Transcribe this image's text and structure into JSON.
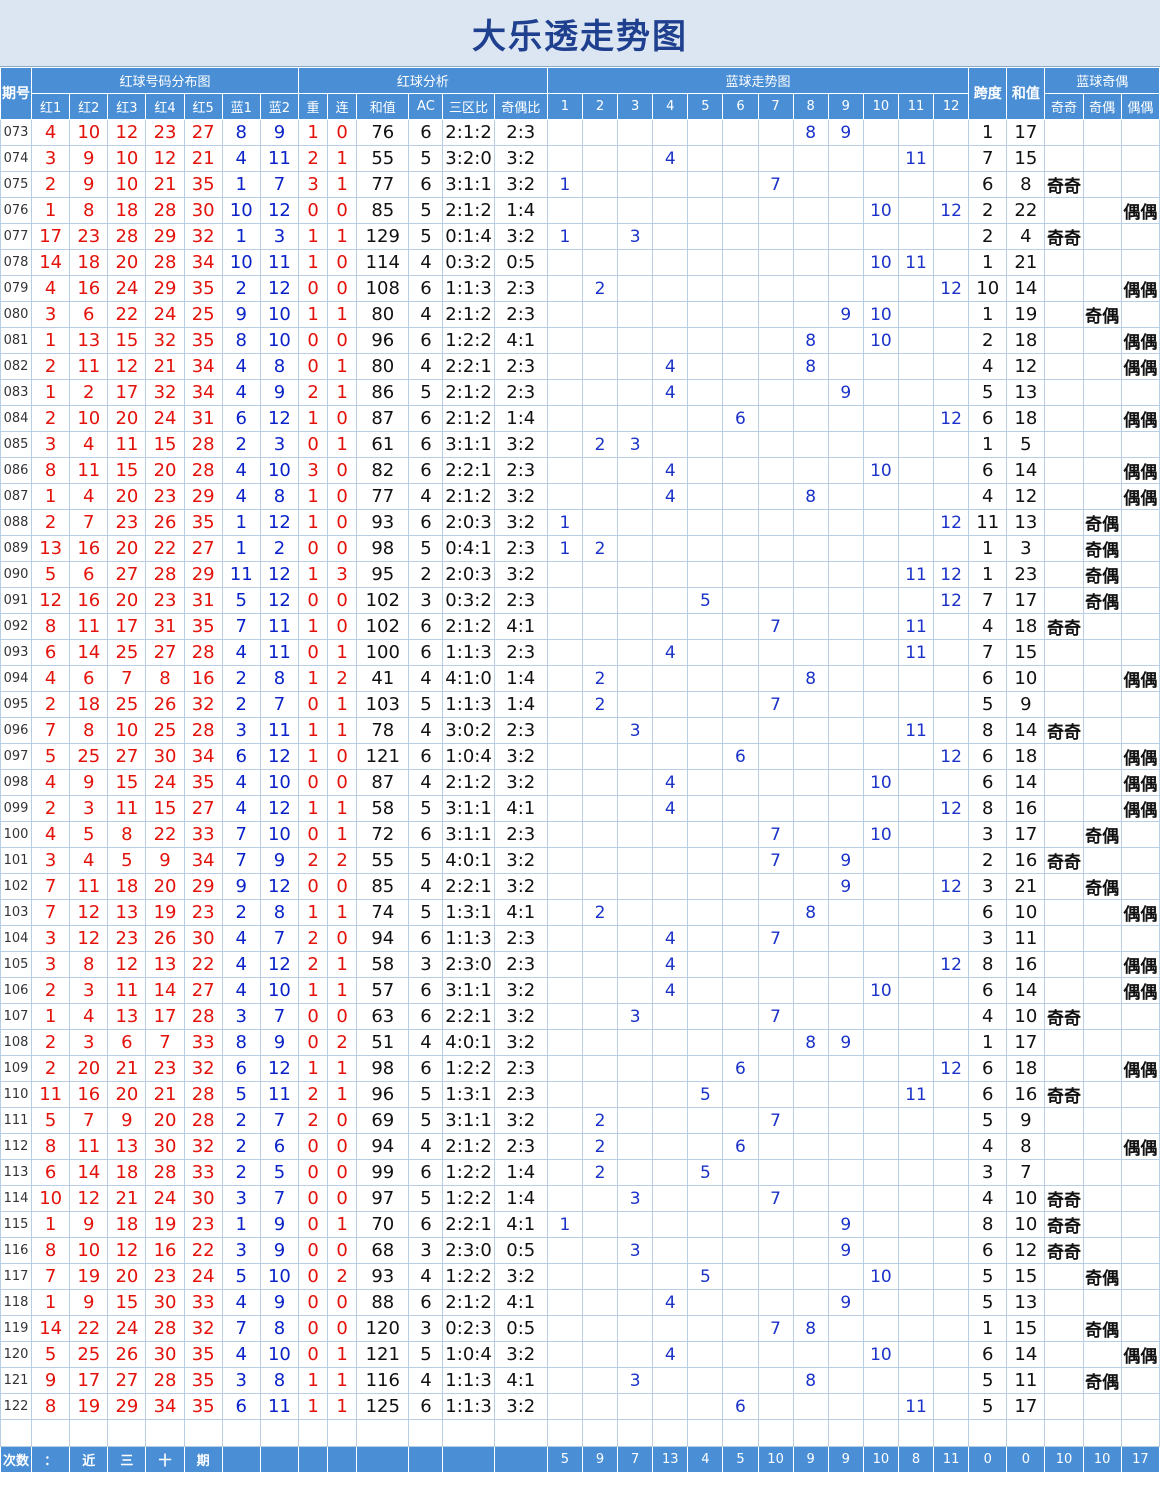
{
  "title": "大乐透走势图",
  "header": {
    "period": "期号",
    "red_dist": "红球号码分布图",
    "red_analysis": "红球分析",
    "blue_trend": "蓝球走势图",
    "span": "跨度",
    "sum": "和值",
    "blue_oe": "蓝球奇偶",
    "cols": [
      "红1",
      "红2",
      "红3",
      "红4",
      "红5",
      "蓝1",
      "蓝2",
      "重",
      "连",
      "和值",
      "AC",
      "三区比",
      "奇偶比",
      "1",
      "2",
      "3",
      "4",
      "5",
      "6",
      "7",
      "8",
      "9",
      "10",
      "11",
      "12",
      "奇奇",
      "奇偶",
      "偶偶"
    ]
  },
  "rows": [
    {
      "p": "073",
      "r": [
        "4",
        "10",
        "12",
        "23",
        "27"
      ],
      "b": [
        "8",
        "9"
      ],
      "c": "1",
      "l": "0",
      "s": "76",
      "ac": "6",
      "z": "2:1:2",
      "oe": "2:3",
      "kd": "1",
      "hz": "17",
      "o": ""
    },
    {
      "p": "074",
      "r": [
        "3",
        "9",
        "10",
        "12",
        "21"
      ],
      "b": [
        "4",
        "11"
      ],
      "c": "2",
      "l": "1",
      "s": "55",
      "ac": "5",
      "z": "3:2:0",
      "oe": "3:2",
      "kd": "7",
      "hz": "15",
      "o": ""
    },
    {
      "p": "075",
      "r": [
        "2",
        "9",
        "10",
        "21",
        "35"
      ],
      "b": [
        "1",
        "7"
      ],
      "c": "3",
      "l": "1",
      "s": "77",
      "ac": "6",
      "z": "3:1:1",
      "oe": "3:2",
      "kd": "6",
      "hz": "8",
      "o": "奇奇"
    },
    {
      "p": "076",
      "r": [
        "1",
        "8",
        "18",
        "28",
        "30"
      ],
      "b": [
        "10",
        "12"
      ],
      "c": "0",
      "l": "0",
      "s": "85",
      "ac": "5",
      "z": "2:1:2",
      "oe": "1:4",
      "kd": "2",
      "hz": "22",
      "o": "偶偶"
    },
    {
      "p": "077",
      "r": [
        "17",
        "23",
        "28",
        "29",
        "32"
      ],
      "b": [
        "1",
        "3"
      ],
      "c": "1",
      "l": "1",
      "s": "129",
      "ac": "5",
      "z": "0:1:4",
      "oe": "3:2",
      "kd": "2",
      "hz": "4",
      "o": "奇奇"
    },
    {
      "p": "078",
      "r": [
        "14",
        "18",
        "20",
        "28",
        "34"
      ],
      "b": [
        "10",
        "11"
      ],
      "c": "1",
      "l": "0",
      "s": "114",
      "ac": "4",
      "z": "0:3:2",
      "oe": "0:5",
      "kd": "1",
      "hz": "21",
      "o": ""
    },
    {
      "p": "079",
      "r": [
        "4",
        "16",
        "24",
        "29",
        "35"
      ],
      "b": [
        "2",
        "12"
      ],
      "c": "0",
      "l": "0",
      "s": "108",
      "ac": "6",
      "z": "1:1:3",
      "oe": "2:3",
      "kd": "10",
      "hz": "14",
      "o": "偶偶"
    },
    {
      "p": "080",
      "r": [
        "3",
        "6",
        "22",
        "24",
        "25"
      ],
      "b": [
        "9",
        "10"
      ],
      "c": "1",
      "l": "1",
      "s": "80",
      "ac": "4",
      "z": "2:1:2",
      "oe": "2:3",
      "kd": "1",
      "hz": "19",
      "o": "奇偶"
    },
    {
      "p": "081",
      "r": [
        "1",
        "13",
        "15",
        "32",
        "35"
      ],
      "b": [
        "8",
        "10"
      ],
      "c": "0",
      "l": "0",
      "s": "96",
      "ac": "6",
      "z": "1:2:2",
      "oe": "4:1",
      "kd": "2",
      "hz": "18",
      "o": "偶偶"
    },
    {
      "p": "082",
      "r": [
        "2",
        "11",
        "12",
        "21",
        "34"
      ],
      "b": [
        "4",
        "8"
      ],
      "c": "0",
      "l": "1",
      "s": "80",
      "ac": "4",
      "z": "2:2:1",
      "oe": "2:3",
      "kd": "4",
      "hz": "12",
      "o": "偶偶"
    },
    {
      "p": "083",
      "r": [
        "1",
        "2",
        "17",
        "32",
        "34"
      ],
      "b": [
        "4",
        "9"
      ],
      "c": "2",
      "l": "1",
      "s": "86",
      "ac": "5",
      "z": "2:1:2",
      "oe": "2:3",
      "kd": "5",
      "hz": "13",
      "o": ""
    },
    {
      "p": "084",
      "r": [
        "2",
        "10",
        "20",
        "24",
        "31"
      ],
      "b": [
        "6",
        "12"
      ],
      "c": "1",
      "l": "0",
      "s": "87",
      "ac": "6",
      "z": "2:1:2",
      "oe": "1:4",
      "kd": "6",
      "hz": "18",
      "o": "偶偶"
    },
    {
      "p": "085",
      "r": [
        "3",
        "4",
        "11",
        "15",
        "28"
      ],
      "b": [
        "2",
        "3"
      ],
      "c": "0",
      "l": "1",
      "s": "61",
      "ac": "6",
      "z": "3:1:1",
      "oe": "3:2",
      "kd": "1",
      "hz": "5",
      "o": ""
    },
    {
      "p": "086",
      "r": [
        "8",
        "11",
        "15",
        "20",
        "28"
      ],
      "b": [
        "4",
        "10"
      ],
      "c": "3",
      "l": "0",
      "s": "82",
      "ac": "6",
      "z": "2:2:1",
      "oe": "2:3",
      "kd": "6",
      "hz": "14",
      "o": "偶偶"
    },
    {
      "p": "087",
      "r": [
        "1",
        "4",
        "20",
        "23",
        "29"
      ],
      "b": [
        "4",
        "8"
      ],
      "c": "1",
      "l": "0",
      "s": "77",
      "ac": "4",
      "z": "2:1:2",
      "oe": "3:2",
      "kd": "4",
      "hz": "12",
      "o": "偶偶"
    },
    {
      "p": "088",
      "r": [
        "2",
        "7",
        "23",
        "26",
        "35"
      ],
      "b": [
        "1",
        "12"
      ],
      "c": "1",
      "l": "0",
      "s": "93",
      "ac": "6",
      "z": "2:0:3",
      "oe": "3:2",
      "kd": "11",
      "hz": "13",
      "o": "奇偶"
    },
    {
      "p": "089",
      "r": [
        "13",
        "16",
        "20",
        "22",
        "27"
      ],
      "b": [
        "1",
        "2"
      ],
      "c": "0",
      "l": "0",
      "s": "98",
      "ac": "5",
      "z": "0:4:1",
      "oe": "2:3",
      "kd": "1",
      "hz": "3",
      "o": "奇偶"
    },
    {
      "p": "090",
      "r": [
        "5",
        "6",
        "27",
        "28",
        "29"
      ],
      "b": [
        "11",
        "12"
      ],
      "c": "1",
      "l": "3",
      "s": "95",
      "ac": "2",
      "z": "2:0:3",
      "oe": "3:2",
      "kd": "1",
      "hz": "23",
      "o": "奇偶"
    },
    {
      "p": "091",
      "r": [
        "12",
        "16",
        "20",
        "23",
        "31"
      ],
      "b": [
        "5",
        "12"
      ],
      "c": "0",
      "l": "0",
      "s": "102",
      "ac": "3",
      "z": "0:3:2",
      "oe": "2:3",
      "kd": "7",
      "hz": "17",
      "o": "奇偶"
    },
    {
      "p": "092",
      "r": [
        "8",
        "11",
        "17",
        "31",
        "35"
      ],
      "b": [
        "7",
        "11"
      ],
      "c": "1",
      "l": "0",
      "s": "102",
      "ac": "6",
      "z": "2:1:2",
      "oe": "4:1",
      "kd": "4",
      "hz": "18",
      "o": "奇奇"
    },
    {
      "p": "093",
      "r": [
        "6",
        "14",
        "25",
        "27",
        "28"
      ],
      "b": [
        "4",
        "11"
      ],
      "c": "0",
      "l": "1",
      "s": "100",
      "ac": "6",
      "z": "1:1:3",
      "oe": "2:3",
      "kd": "7",
      "hz": "15",
      "o": ""
    },
    {
      "p": "094",
      "r": [
        "4",
        "6",
        "7",
        "8",
        "16"
      ],
      "b": [
        "2",
        "8"
      ],
      "c": "1",
      "l": "2",
      "s": "41",
      "ac": "4",
      "z": "4:1:0",
      "oe": "1:4",
      "kd": "6",
      "hz": "10",
      "o": "偶偶"
    },
    {
      "p": "095",
      "r": [
        "2",
        "18",
        "25",
        "26",
        "32"
      ],
      "b": [
        "2",
        "7"
      ],
      "c": "0",
      "l": "1",
      "s": "103",
      "ac": "5",
      "z": "1:1:3",
      "oe": "1:4",
      "kd": "5",
      "hz": "9",
      "o": ""
    },
    {
      "p": "096",
      "r": [
        "7",
        "8",
        "10",
        "25",
        "28"
      ],
      "b": [
        "3",
        "11"
      ],
      "c": "1",
      "l": "1",
      "s": "78",
      "ac": "4",
      "z": "3:0:2",
      "oe": "2:3",
      "kd": "8",
      "hz": "14",
      "o": "奇奇"
    },
    {
      "p": "097",
      "r": [
        "5",
        "25",
        "27",
        "30",
        "34"
      ],
      "b": [
        "6",
        "12"
      ],
      "c": "1",
      "l": "0",
      "s": "121",
      "ac": "6",
      "z": "1:0:4",
      "oe": "3:2",
      "kd": "6",
      "hz": "18",
      "o": "偶偶"
    },
    {
      "p": "098",
      "r": [
        "4",
        "9",
        "15",
        "24",
        "35"
      ],
      "b": [
        "4",
        "10"
      ],
      "c": "0",
      "l": "0",
      "s": "87",
      "ac": "4",
      "z": "2:1:2",
      "oe": "3:2",
      "kd": "6",
      "hz": "14",
      "o": "偶偶"
    },
    {
      "p": "099",
      "r": [
        "2",
        "3",
        "11",
        "15",
        "27"
      ],
      "b": [
        "4",
        "12"
      ],
      "c": "1",
      "l": "1",
      "s": "58",
      "ac": "5",
      "z": "3:1:1",
      "oe": "4:1",
      "kd": "8",
      "hz": "16",
      "o": "偶偶"
    },
    {
      "p": "100",
      "r": [
        "4",
        "5",
        "8",
        "22",
        "33"
      ],
      "b": [
        "7",
        "10"
      ],
      "c": "0",
      "l": "1",
      "s": "72",
      "ac": "6",
      "z": "3:1:1",
      "oe": "2:3",
      "kd": "3",
      "hz": "17",
      "o": "奇偶"
    },
    {
      "p": "101",
      "r": [
        "3",
        "4",
        "5",
        "9",
        "34"
      ],
      "b": [
        "7",
        "9"
      ],
      "c": "2",
      "l": "2",
      "s": "55",
      "ac": "5",
      "z": "4:0:1",
      "oe": "3:2",
      "kd": "2",
      "hz": "16",
      "o": "奇奇"
    },
    {
      "p": "102",
      "r": [
        "7",
        "11",
        "18",
        "20",
        "29"
      ],
      "b": [
        "9",
        "12"
      ],
      "c": "0",
      "l": "0",
      "s": "85",
      "ac": "4",
      "z": "2:2:1",
      "oe": "3:2",
      "kd": "3",
      "hz": "21",
      "o": "奇偶"
    },
    {
      "p": "103",
      "r": [
        "7",
        "12",
        "13",
        "19",
        "23"
      ],
      "b": [
        "2",
        "8"
      ],
      "c": "1",
      "l": "1",
      "s": "74",
      "ac": "5",
      "z": "1:3:1",
      "oe": "4:1",
      "kd": "6",
      "hz": "10",
      "o": "偶偶"
    },
    {
      "p": "104",
      "r": [
        "3",
        "12",
        "23",
        "26",
        "30"
      ],
      "b": [
        "4",
        "7"
      ],
      "c": "2",
      "l": "0",
      "s": "94",
      "ac": "6",
      "z": "1:1:3",
      "oe": "2:3",
      "kd": "3",
      "hz": "11",
      "o": ""
    },
    {
      "p": "105",
      "r": [
        "3",
        "8",
        "12",
        "13",
        "22"
      ],
      "b": [
        "4",
        "12"
      ],
      "c": "2",
      "l": "1",
      "s": "58",
      "ac": "3",
      "z": "2:3:0",
      "oe": "2:3",
      "kd": "8",
      "hz": "16",
      "o": "偶偶"
    },
    {
      "p": "106",
      "r": [
        "2",
        "3",
        "11",
        "14",
        "27"
      ],
      "b": [
        "4",
        "10"
      ],
      "c": "1",
      "l": "1",
      "s": "57",
      "ac": "6",
      "z": "3:1:1",
      "oe": "3:2",
      "kd": "6",
      "hz": "14",
      "o": "偶偶"
    },
    {
      "p": "107",
      "r": [
        "1",
        "4",
        "13",
        "17",
        "28"
      ],
      "b": [
        "3",
        "7"
      ],
      "c": "0",
      "l": "0",
      "s": "63",
      "ac": "6",
      "z": "2:2:1",
      "oe": "3:2",
      "kd": "4",
      "hz": "10",
      "o": "奇奇"
    },
    {
      "p": "108",
      "r": [
        "2",
        "3",
        "6",
        "7",
        "33"
      ],
      "b": [
        "8",
        "9"
      ],
      "c": "0",
      "l": "2",
      "s": "51",
      "ac": "4",
      "z": "4:0:1",
      "oe": "3:2",
      "kd": "1",
      "hz": "17",
      "o": ""
    },
    {
      "p": "109",
      "r": [
        "2",
        "20",
        "21",
        "23",
        "32"
      ],
      "b": [
        "6",
        "12"
      ],
      "c": "1",
      "l": "1",
      "s": "98",
      "ac": "6",
      "z": "1:2:2",
      "oe": "2:3",
      "kd": "6",
      "hz": "18",
      "o": "偶偶"
    },
    {
      "p": "110",
      "r": [
        "11",
        "16",
        "20",
        "21",
        "28"
      ],
      "b": [
        "5",
        "11"
      ],
      "c": "2",
      "l": "1",
      "s": "96",
      "ac": "5",
      "z": "1:3:1",
      "oe": "2:3",
      "kd": "6",
      "hz": "16",
      "o": "奇奇"
    },
    {
      "p": "111",
      "r": [
        "5",
        "7",
        "9",
        "20",
        "28"
      ],
      "b": [
        "2",
        "7"
      ],
      "c": "2",
      "l": "0",
      "s": "69",
      "ac": "5",
      "z": "3:1:1",
      "oe": "3:2",
      "kd": "5",
      "hz": "9",
      "o": ""
    },
    {
      "p": "112",
      "r": [
        "8",
        "11",
        "13",
        "30",
        "32"
      ],
      "b": [
        "2",
        "6"
      ],
      "c": "0",
      "l": "0",
      "s": "94",
      "ac": "4",
      "z": "2:1:2",
      "oe": "2:3",
      "kd": "4",
      "hz": "8",
      "o": "偶偶"
    },
    {
      "p": "113",
      "r": [
        "6",
        "14",
        "18",
        "28",
        "33"
      ],
      "b": [
        "2",
        "5"
      ],
      "c": "0",
      "l": "0",
      "s": "99",
      "ac": "6",
      "z": "1:2:2",
      "oe": "1:4",
      "kd": "3",
      "hz": "7",
      "o": ""
    },
    {
      "p": "114",
      "r": [
        "10",
        "12",
        "21",
        "24",
        "30"
      ],
      "b": [
        "3",
        "7"
      ],
      "c": "0",
      "l": "0",
      "s": "97",
      "ac": "5",
      "z": "1:2:2",
      "oe": "1:4",
      "kd": "4",
      "hz": "10",
      "o": "奇奇"
    },
    {
      "p": "115",
      "r": [
        "1",
        "9",
        "18",
        "19",
        "23"
      ],
      "b": [
        "1",
        "9"
      ],
      "c": "0",
      "l": "1",
      "s": "70",
      "ac": "6",
      "z": "2:2:1",
      "oe": "4:1",
      "kd": "8",
      "hz": "10",
      "o": "奇奇"
    },
    {
      "p": "116",
      "r": [
        "8",
        "10",
        "12",
        "16",
        "22"
      ],
      "b": [
        "3",
        "9"
      ],
      "c": "0",
      "l": "0",
      "s": "68",
      "ac": "3",
      "z": "2:3:0",
      "oe": "0:5",
      "kd": "6",
      "hz": "12",
      "o": "奇奇"
    },
    {
      "p": "117",
      "r": [
        "7",
        "19",
        "20",
        "23",
        "24"
      ],
      "b": [
        "5",
        "10"
      ],
      "c": "0",
      "l": "2",
      "s": "93",
      "ac": "4",
      "z": "1:2:2",
      "oe": "3:2",
      "kd": "5",
      "hz": "15",
      "o": "奇偶"
    },
    {
      "p": "118",
      "r": [
        "1",
        "9",
        "15",
        "30",
        "33"
      ],
      "b": [
        "4",
        "9"
      ],
      "c": "0",
      "l": "0",
      "s": "88",
      "ac": "6",
      "z": "2:1:2",
      "oe": "4:1",
      "kd": "5",
      "hz": "13",
      "o": ""
    },
    {
      "p": "119",
      "r": [
        "14",
        "22",
        "24",
        "28",
        "32"
      ],
      "b": [
        "7",
        "8"
      ],
      "c": "0",
      "l": "0",
      "s": "120",
      "ac": "3",
      "z": "0:2:3",
      "oe": "0:5",
      "kd": "1",
      "hz": "15",
      "o": "奇偶"
    },
    {
      "p": "120",
      "r": [
        "5",
        "25",
        "26",
        "30",
        "35"
      ],
      "b": [
        "4",
        "10"
      ],
      "c": "0",
      "l": "1",
      "s": "121",
      "ac": "5",
      "z": "1:0:4",
      "oe": "3:2",
      "kd": "6",
      "hz": "14",
      "o": "偶偶"
    },
    {
      "p": "121",
      "r": [
        "9",
        "17",
        "27",
        "28",
        "35"
      ],
      "b": [
        "3",
        "8"
      ],
      "c": "1",
      "l": "1",
      "s": "116",
      "ac": "4",
      "z": "1:1:3",
      "oe": "4:1",
      "kd": "5",
      "hz": "11",
      "o": "奇偶"
    },
    {
      "p": "122",
      "r": [
        "8",
        "19",
        "29",
        "34",
        "35"
      ],
      "b": [
        "6",
        "11"
      ],
      "c": "1",
      "l": "1",
      "s": "125",
      "ac": "6",
      "z": "1:1:3",
      "oe": "3:2",
      "kd": "5",
      "hz": "17",
      "o": ""
    }
  ],
  "footer": {
    "labels": [
      "次数",
      "：",
      "近",
      "三",
      "十",
      "期"
    ],
    "blue_counts": [
      "5",
      "9",
      "7",
      "13",
      "4",
      "5",
      "10",
      "9",
      "9",
      "10",
      "8",
      "11"
    ],
    "span_count": "0",
    "sum_count": "0",
    "oe_counts": [
      "10",
      "10",
      "17"
    ]
  }
}
